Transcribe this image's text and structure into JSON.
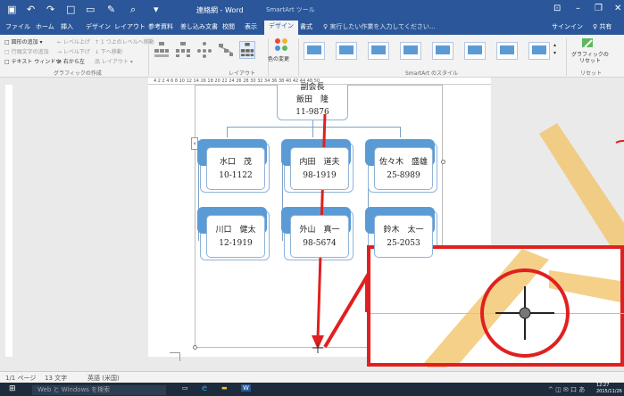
{
  "window": {
    "title": "連絡網 - Word",
    "context_tool": "SmartArt ツール"
  },
  "tabs": [
    "ファイル",
    "ホーム",
    "挿入",
    "デザイン",
    "レイアウト",
    "参考資料",
    "差し込み文書",
    "校閲",
    "表示",
    "デザイン",
    "書式"
  ],
  "tell_me": "♀ 実行したい作業を入力してください...",
  "account": {
    "signin": "サインイン",
    "share": "♀ 共有"
  },
  "ribbon": {
    "create_graphic": {
      "add_shape": "□ 図形の追加 ▾",
      "add_bullet": "□ 行頭文字の追加",
      "text_pane": "□ テキスト ウィンドウ",
      "promote": "← レベル上げ",
      "demote": "→ レベル下げ",
      "right_to_left": "⇄ 右から左",
      "move_up": "↑ 1 つ上のレベルへ移動",
      "move_down": "↓ 下へ移動",
      "layout": "品 レイアウト ▾",
      "group_label": "グラフィックの作成"
    },
    "layouts_label": "レイアウト",
    "change_colors": "色の変更",
    "styles_label": "SmartArt のスタイル",
    "reset_graphic": "グラフィックの\nリセット",
    "reset_label": "リセット"
  },
  "ruler": {
    "marks": "4  2     2  4  6  8  10  12  14  16  18  20  22  24  26  28  30  32  34  36  38  40  42  44     48  50"
  },
  "org_chart": {
    "top": [
      "副会長",
      "飯田　隆",
      "11-9876"
    ],
    "row1": [
      [
        "水口　茂",
        "10-1122"
      ],
      [
        "内田　道夫",
        "98-1919"
      ],
      [
        "佐々木　盛雄",
        "25-8989"
      ]
    ],
    "row2": [
      [
        "川口　健太",
        "12-1919"
      ],
      [
        "外山　真一",
        "98-5674"
      ],
      [
        "鈴木　太一",
        "25-2053"
      ]
    ]
  },
  "status": {
    "page": "1/1 ページ",
    "words": "13 文字",
    "lang": "英語 (米国)"
  },
  "taskbar": {
    "search": "Web と Windows を検索",
    "time": "12:27",
    "date": "2015/11/26"
  },
  "colors": {
    "brand": "#2b579a",
    "highlight": "#e02020",
    "accent": "#5b9bd5",
    "marker": "#f2c46a"
  }
}
